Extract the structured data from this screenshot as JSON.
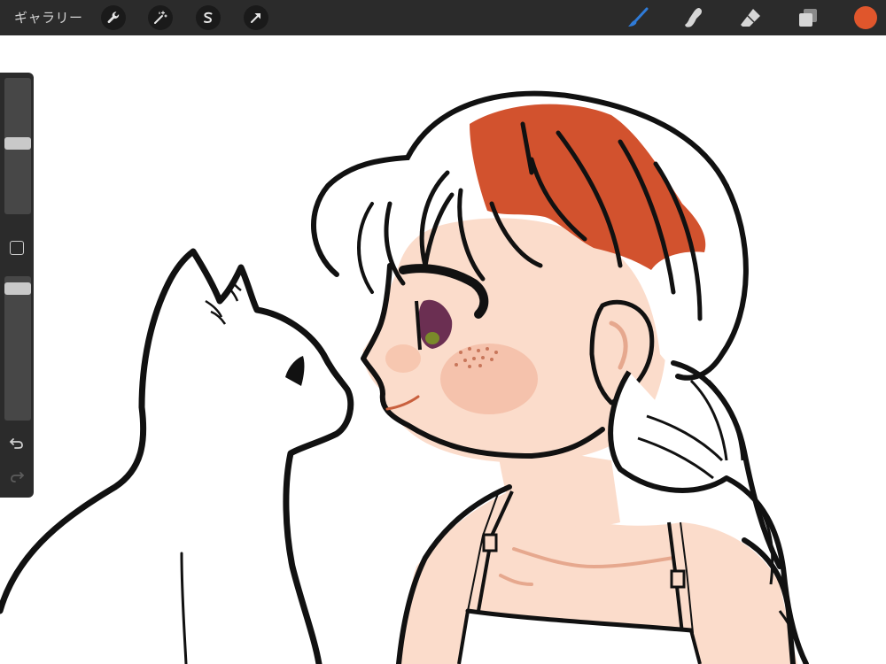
{
  "toolbar": {
    "gallery_label": "ギャラリー",
    "left_tools": [
      "wrench-icon",
      "magic-wand-icon",
      "selection-icon",
      "transform-arrow-icon"
    ],
    "right_tools": [
      "brush-icon",
      "smudge-icon",
      "eraser-icon",
      "layers-icon"
    ],
    "active_tool": "brush",
    "current_color": "#E0562C",
    "brush_tool_color": "#2F7BD8"
  },
  "sidebar": {
    "brush_size_level": 0.52,
    "opacity_level": 0.95,
    "icons": [
      "modify-square-icon",
      "undo-icon",
      "redo-icon"
    ]
  },
  "canvas": {
    "background": "#FFFFFF",
    "artwork": "girl-and-cat-sketch",
    "colors": {
      "hair_fill": "#D2522E",
      "skin": "#FBDCCB",
      "skin_shadow": "#F7C2A8",
      "line": "#111111",
      "cheek": "#F5B9A2",
      "eye": "#6B2F52",
      "eye_highlight": "#7A8A2A",
      "freckles": "#C8765A",
      "strap_line": "#E6A88E"
    }
  }
}
